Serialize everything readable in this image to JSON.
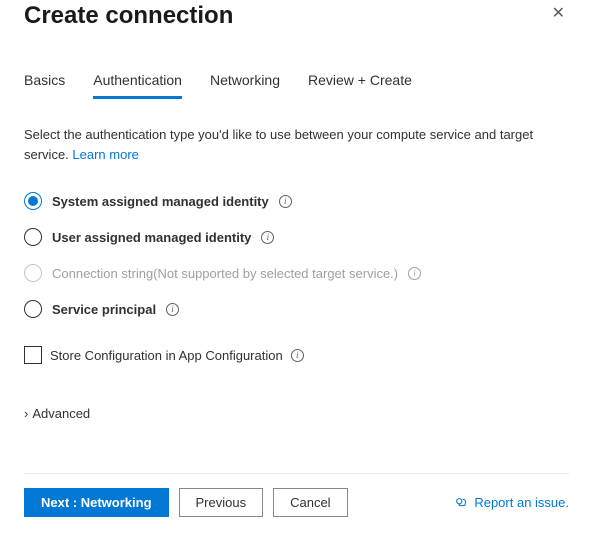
{
  "header": {
    "title": "Create connection"
  },
  "tabs": {
    "items": [
      {
        "label": "Basics"
      },
      {
        "label": "Authentication"
      },
      {
        "label": "Networking"
      },
      {
        "label": "Review + Create"
      }
    ],
    "active_index": 1
  },
  "description": {
    "text": "Select the authentication type you'd like to use between your compute service and target service. ",
    "link": "Learn more"
  },
  "auth_options": [
    {
      "label": "System assigned managed identity",
      "selected": true,
      "disabled": false,
      "hint": ""
    },
    {
      "label": "User assigned managed identity",
      "selected": false,
      "disabled": false,
      "hint": ""
    },
    {
      "label": "Connection string",
      "selected": false,
      "disabled": true,
      "hint": "(Not supported by selected target service.)"
    },
    {
      "label": "Service principal",
      "selected": false,
      "disabled": false,
      "hint": ""
    }
  ],
  "checkbox": {
    "label": "Store Configuration in App Configuration",
    "checked": false
  },
  "advanced": {
    "label": "Advanced"
  },
  "footer": {
    "next": "Next : Networking",
    "prev": "Previous",
    "cancel": "Cancel",
    "report": "Report an issue."
  }
}
